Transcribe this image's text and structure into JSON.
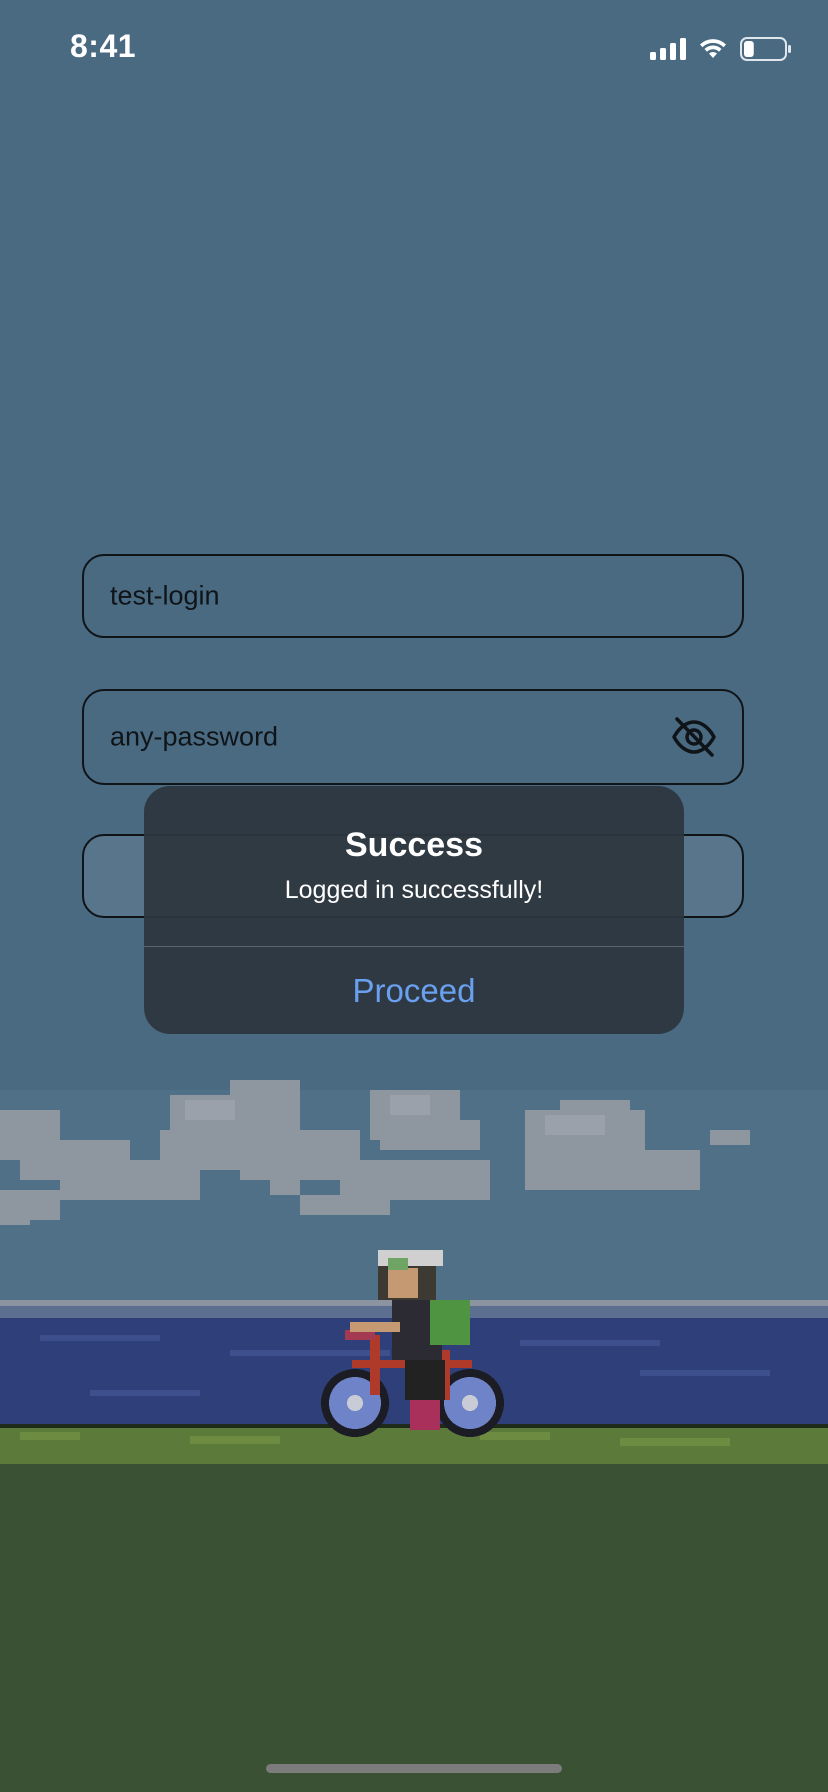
{
  "status_bar": {
    "time": "8:41",
    "icons": [
      "cellular-signal-icon",
      "wifi-icon",
      "battery-icon"
    ],
    "battery_level": 0.25
  },
  "form": {
    "login_value": "test-login",
    "password_value": "any-password",
    "visibility_icon": "eye-off-icon"
  },
  "alert": {
    "title": "Success",
    "message": "Logged in successfully!",
    "action_label": "Proceed"
  },
  "colors": {
    "sky": "#4a6a82",
    "alert_background": "#2e363f",
    "action_text": "#6aa0f0",
    "sea": "#2f3f7a",
    "grass": "#5c7a3a",
    "ground": "#3a5233"
  }
}
